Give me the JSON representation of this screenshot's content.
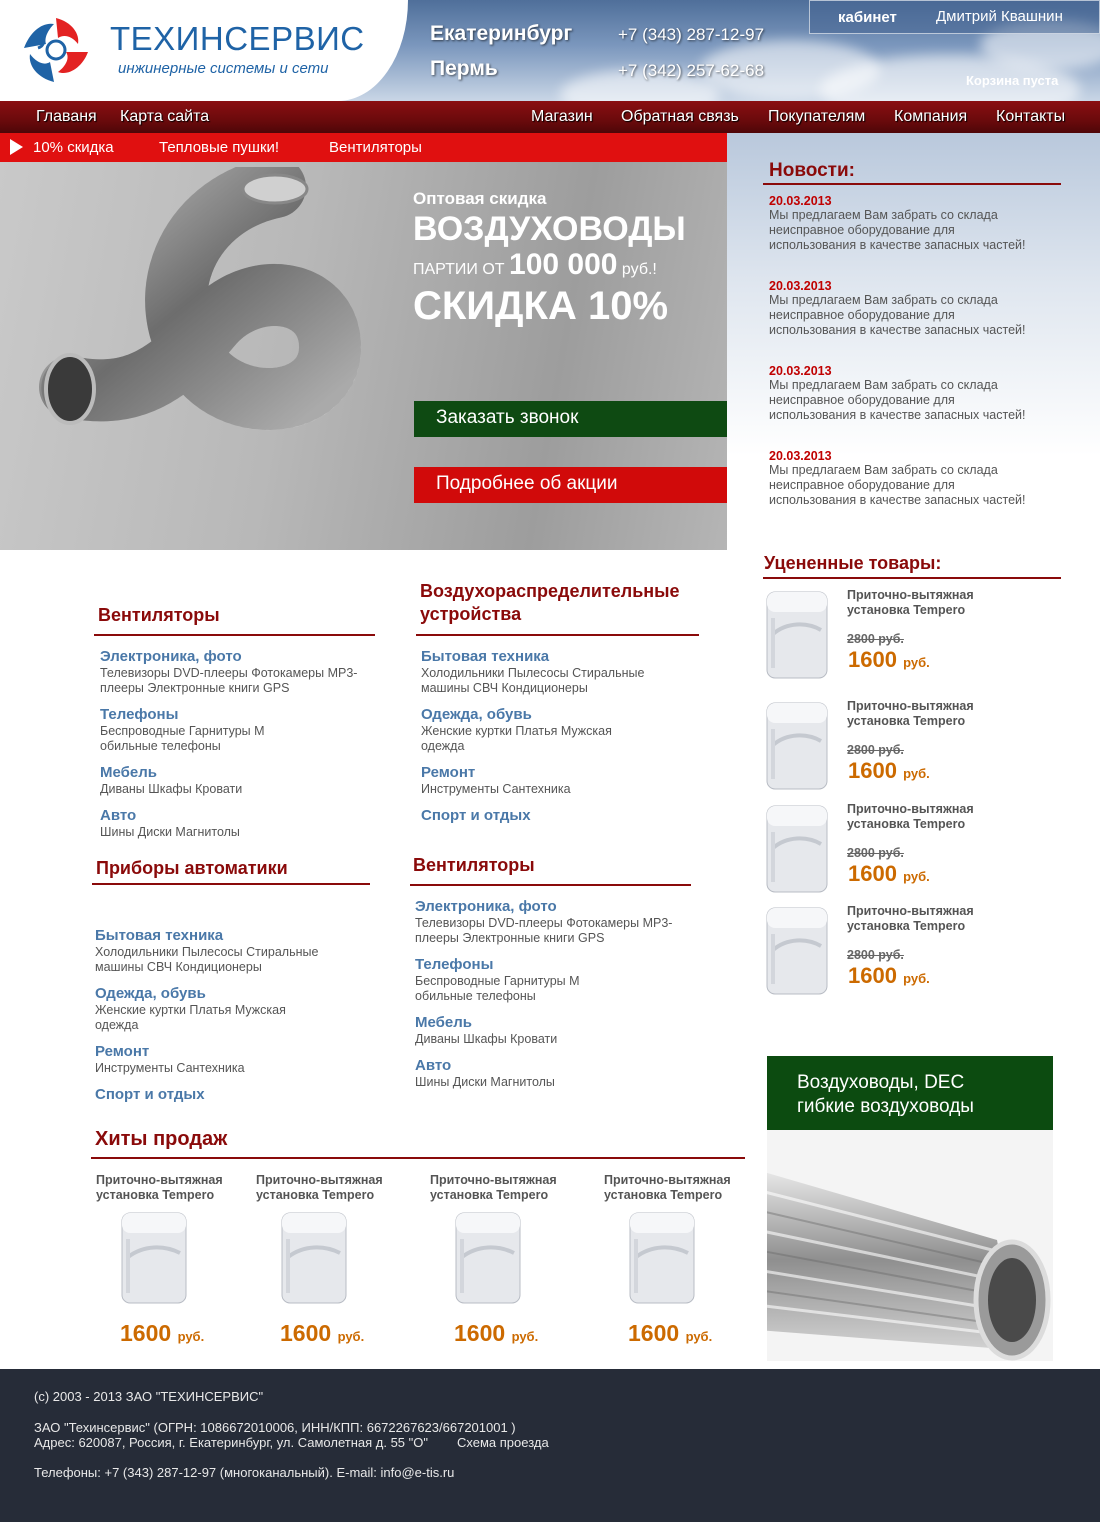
{
  "header": {
    "logo_title": "ТЕХИНСЕРВИС",
    "logo_subtitle": "инжинерные системы и сети",
    "cities": [
      {
        "name": "Екатеринбург",
        "phone": "+7 (343) 287-12-97"
      },
      {
        "name": "Пермь",
        "phone": "+7 (342) 257-62-68"
      }
    ],
    "account_label": "кабинет",
    "account_user": "Дмитрий Квашнин",
    "cart_status": "Корзина пуста"
  },
  "nav": {
    "left": [
      "Главаня",
      "Карта сайта"
    ],
    "right": [
      "Магазин",
      "Обратная связь",
      "Покупателям",
      "Компания",
      "Контакты"
    ]
  },
  "promo_bar": [
    "10% скидка",
    "Тепловые пушки!",
    "Вентиляторы"
  ],
  "banner": {
    "kicker": "Оптовая скидка",
    "title": "ВОЗДУХОВОДЫ",
    "batch_prefix": "ПАРТИИ ОТ",
    "batch_amount": "100 000",
    "batch_unit": "руб.!",
    "discount": "СКИДКА 10%",
    "btn_callback": "Заказать звонок",
    "btn_details": "Подробнее об акции"
  },
  "news": {
    "heading": "Новости:",
    "items": [
      {
        "date": "20.03.2013",
        "text": "Мы предлагаем Вам забрать со склада неисправное оборудование для использования в качестве запасных частей!"
      },
      {
        "date": "20.03.2013",
        "text": "Мы предлагаем Вам забрать со склада неисправное оборудование для использования в качестве запасных частей!"
      },
      {
        "date": "20.03.2013",
        "text": "Мы предлагаем Вам забрать со склада неисправное оборудование для использования в качестве запасных частей!"
      },
      {
        "date": "20.03.2013",
        "text": "Мы предлагаем Вам забрать со склада неисправное оборудование для использования в качестве запасных частей!"
      }
    ]
  },
  "discounted": {
    "heading": "Уцененные товары:",
    "items": [
      {
        "name": "Приточно-вытяжная установка Tempero",
        "old_price": "2800 руб.",
        "new_price": "1600",
        "currency": "руб."
      },
      {
        "name": "Приточно-вытяжная установка Tempero",
        "old_price": "2800 руб.",
        "new_price": "1600",
        "currency": "руб."
      },
      {
        "name": "Приточно-вытяжная установка Tempero",
        "old_price": "2800 руб.",
        "new_price": "1600",
        "currency": "руб."
      },
      {
        "name": "Приточно-вытяжная установка Tempero",
        "old_price": "2800 руб.",
        "new_price": "1600",
        "currency": "руб."
      }
    ]
  },
  "side_banner": {
    "text": "Воздуховоды, DEC гибкие воздуховоды"
  },
  "catalog": [
    {
      "heading": "Вентиляторы",
      "entries": [
        {
          "title": "Электроника, фото",
          "desc": "Телевизоры DVD-плееры Фотокамеры MP3-плееры Электронные книги GPS"
        },
        {
          "title": "Телефоны",
          "desc": "Беспроводные Гарнитуры М обильные телефоны"
        },
        {
          "title": "Мебель",
          "desc": "Диваны Шкафы Кровати"
        },
        {
          "title": "Авто",
          "desc": "Шины Диски Магнитолы"
        }
      ]
    },
    {
      "heading": "Воздухораспределительные устройства",
      "entries": [
        {
          "title": "Бытовая техника",
          "desc": "Холодильники Пылесосы Стиральные машины СВЧ Кондиционеры"
        },
        {
          "title": "Одежда, обувь",
          "desc": "Женские куртки Платья Мужская одежда"
        },
        {
          "title": "Ремонт",
          "desc": "Инструменты Сантехника"
        },
        {
          "title": "Спорт и отдых",
          "desc": ""
        }
      ]
    },
    {
      "heading": "Приборы автоматики",
      "entries": [
        {
          "title": "Бытовая техника",
          "desc": "Холодильники Пылесосы Стиральные машины СВЧ Кондиционеры"
        },
        {
          "title": "Одежда, обувь",
          "desc": "Женские куртки Платья Мужская одежда"
        },
        {
          "title": "Ремонт",
          "desc": "Инструменты Сантехника"
        },
        {
          "title": "Спорт и отдых",
          "desc": ""
        }
      ]
    },
    {
      "heading": "Вентиляторы",
      "entries": [
        {
          "title": "Электроника, фото",
          "desc": "Телевизоры DVD-плееры Фотокамеры MP3-плееры Электронные книги GPS"
        },
        {
          "title": "Телефоны",
          "desc": "Беспроводные Гарнитуры М обильные телефоны"
        },
        {
          "title": "Мебель",
          "desc": "Диваны Шкафы Кровати"
        },
        {
          "title": "Авто",
          "desc": "Шины Диски Магнитолы"
        }
      ]
    }
  ],
  "hits": {
    "heading": "Хиты продаж",
    "items": [
      {
        "name": "Приточно-вытяжная установка Tempero",
        "price": "1600",
        "currency": "руб."
      },
      {
        "name": "Приточно-вытяжная установка Tempero",
        "price": "1600",
        "currency": "руб."
      },
      {
        "name": "Приточно-вытяжная установка Tempero",
        "price": "1600",
        "currency": "руб."
      },
      {
        "name": "Приточно-вытяжная установка Tempero",
        "price": "1600",
        "currency": "руб."
      }
    ]
  },
  "footer": {
    "copyright": "(c) 2003 - 2013  ЗАО \"ТЕХИНСЕРВИС\"",
    "legal": "ЗАО \"Техинсервис\" (ОГРН: 1086672010006, ИНН/КПП: 6672267623/667201001 )",
    "address": "Адрес: 620087, Россия, г. Екатеринбург, ул. Самолетная д. 55 \"О\"",
    "map_link": "Схема проезда",
    "contacts": "Телефоны: +7 (343) 287-12-97 (многоканальный). E-mail: info@e-tis.ru"
  },
  "colors": {
    "brand_blue": "#1f63a6",
    "nav_red": "#6b0a0c",
    "promo_red": "#e01010",
    "heading_red": "#8a0a0a",
    "link_blue": "#4a78a8",
    "price_orange": "#cc6a00",
    "button_green": "#0e4a12",
    "footer_bg": "#262c38"
  },
  "icons": [
    "logo-mark-icon",
    "play-arrow-icon"
  ]
}
